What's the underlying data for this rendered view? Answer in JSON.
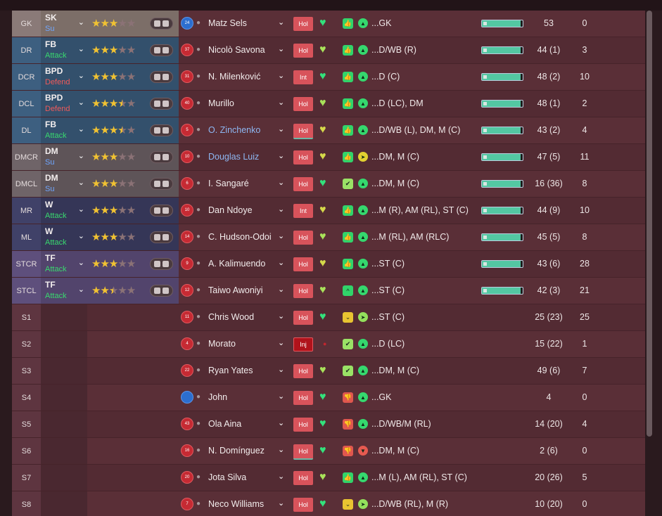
{
  "colors": {
    "row_odd": "#5a2f37",
    "row_even": "#532b33",
    "gk_cell": "#8a7a78",
    "def_cell": "#335677",
    "mid_cell": "#6e6266",
    "wide_cell": "#3f3f66",
    "att_cell": "#5d4d7a",
    "duty_attack": "#39d96f",
    "duty_defend": "#ef5a5a",
    "duty_support": "#6fa6ff",
    "status_hol": "#d8535b",
    "status_inj": "#b0121b",
    "fitness_bar": "#53c7a2"
  },
  "players": [
    {
      "pos": "GK",
      "role": "SK",
      "duty": "Su",
      "duty_type": "support",
      "pos_color": "#8a7a78",
      "role_color": "#7c6e68",
      "stars": 3,
      "shirt": "24",
      "gk": true,
      "name": "Matz Sels",
      "link": false,
      "status": "Hol",
      "heart": "g",
      "sq": "g",
      "sq_icon": "👍",
      "circ": "g",
      "circ_icon": "▲",
      "position_text": "...GK",
      "fitness": 0.95,
      "apps": "53",
      "goals": "0",
      "bar": true
    },
    {
      "pos": "DR",
      "role": "FB",
      "duty": "Attack",
      "duty_type": "attack",
      "pos_color": "#3d5f80",
      "role_color": "#33506c",
      "stars": 3,
      "shirt": "37",
      "gk": false,
      "name": "Nicolò Savona",
      "link": false,
      "status": "Hol",
      "heart": "lg",
      "sq": "g",
      "sq_icon": "👍",
      "circ": "g",
      "circ_icon": "▲",
      "position_text": "...D/WB (R)",
      "fitness": 0.95,
      "apps": "44 (1)",
      "goals": "3",
      "bar": true
    },
    {
      "pos": "DCR",
      "role": "BPD",
      "duty": "Defend",
      "duty_type": "defend",
      "pos_color": "#3d5f80",
      "role_color": "#33506c",
      "stars": 3,
      "shirt": "31",
      "gk": false,
      "name": "N. Milenković",
      "link": false,
      "status": "Int",
      "heart": "g",
      "sq": "g",
      "sq_icon": "👍",
      "circ": "g",
      "circ_icon": "▲",
      "position_text": "...D (C)",
      "fitness": 0.95,
      "apps": "48 (2)",
      "goals": "10",
      "bar": true
    },
    {
      "pos": "DCL",
      "role": "BPD",
      "duty": "Defend",
      "duty_type": "defend",
      "pos_color": "#3d5f80",
      "role_color": "#33506c",
      "stars": 3.5,
      "shirt": "40",
      "gk": false,
      "name": "Murillo",
      "link": false,
      "status": "Hol",
      "heart": "lg",
      "sq": "g",
      "sq_icon": "👍",
      "circ": "g",
      "circ_icon": "▲",
      "position_text": "...D (LC), DM",
      "fitness": 0.95,
      "apps": "48 (1)",
      "goals": "2",
      "bar": true
    },
    {
      "pos": "DL",
      "role": "FB",
      "duty": "Attack",
      "duty_type": "attack",
      "pos_color": "#3d5f80",
      "role_color": "#33506c",
      "stars": 3.5,
      "shirt": "5",
      "gk": false,
      "name": "O. Zinchenko",
      "link": true,
      "status": "Hol",
      "heart": "y",
      "sq": "g",
      "sq_icon": "👍",
      "circ": "g",
      "circ_icon": "▲",
      "position_text": "...D/WB (L), DM, M (C)",
      "fitness": 0.95,
      "apps": "43 (2)",
      "goals": "4",
      "bar": true
    },
    {
      "pos": "DMCR",
      "role": "DM",
      "duty": "Su",
      "duty_type": "support",
      "pos_color": "#6f6468",
      "role_color": "#5e5458",
      "stars": 3,
      "shirt": "10",
      "gk": false,
      "name": "Douglas Luiz",
      "link": true,
      "status": "Hol",
      "heart": "y",
      "sq": "g",
      "sq_icon": "👍",
      "circ": "y",
      "circ_icon": "➤",
      "position_text": "...DM, M (C)",
      "fitness": 0.95,
      "apps": "47 (5)",
      "goals": "11",
      "bar": true
    },
    {
      "pos": "DMCL",
      "role": "DM",
      "duty": "Su",
      "duty_type": "support",
      "pos_color": "#6f6468",
      "role_color": "#5e5458",
      "stars": 3,
      "shirt": "6",
      "gk": false,
      "name": "I. Sangaré",
      "link": false,
      "status": "Hol",
      "heart": "g",
      "sq": "lg",
      "sq_icon": "✔",
      "circ": "g",
      "circ_icon": "▲",
      "position_text": "...DM, M (C)",
      "fitness": 0.95,
      "apps": "16 (36)",
      "goals": "8",
      "bar": true
    },
    {
      "pos": "MR",
      "role": "W",
      "duty": "Attack",
      "duty_type": "attack",
      "pos_color": "#404168",
      "role_color": "#353657",
      "stars": 3,
      "shirt": "10",
      "gk": false,
      "name": "Dan Ndoye",
      "link": false,
      "status": "Int",
      "heart": "y",
      "sq": "g",
      "sq_icon": "👍",
      "circ": "g",
      "circ_icon": "▲",
      "position_text": "...M (R), AM (RL), ST (C)",
      "fitness": 0.95,
      "apps": "44 (9)",
      "goals": "10",
      "bar": true
    },
    {
      "pos": "ML",
      "role": "W",
      "duty": "Attack",
      "duty_type": "attack",
      "pos_color": "#404168",
      "role_color": "#353657",
      "stars": 3,
      "shirt": "14",
      "gk": false,
      "name": "C. Hudson-Odoi",
      "link": false,
      "status": "Hol",
      "heart": "lg",
      "sq": "g",
      "sq_icon": "👍",
      "circ": "g",
      "circ_icon": "▲",
      "position_text": "...M (RL), AM (RLC)",
      "fitness": 0.95,
      "apps": "45 (5)",
      "goals": "8",
      "bar": true
    },
    {
      "pos": "STCR",
      "role": "TF",
      "duty": "Attack",
      "duty_type": "attack",
      "pos_color": "#5e4f7c",
      "role_color": "#52446c",
      "stars": 3,
      "shirt": "9",
      "gk": false,
      "name": "A. Kalimuendo",
      "link": false,
      "status": "Hol",
      "heart": "y",
      "sq": "g",
      "sq_icon": "👍",
      "circ": "g",
      "circ_icon": "▲",
      "position_text": "...ST (C)",
      "fitness": 0.95,
      "apps": "43 (6)",
      "goals": "28",
      "bar": true
    },
    {
      "pos": "STCL",
      "role": "TF",
      "duty": "Attack",
      "duty_type": "attack",
      "pos_color": "#5e4f7c",
      "role_color": "#52446c",
      "stars": 2.5,
      "shirt": "12",
      "gk": false,
      "name": "Taiwo Awoniyi",
      "link": false,
      "status": "Hol",
      "heart": "lg",
      "sq": "g",
      "sq_icon": "^",
      "circ": "g",
      "circ_icon": "▲",
      "position_text": "...ST (C)",
      "fitness": 0.95,
      "apps": "42 (3)",
      "goals": "21",
      "bar": true
    },
    {
      "pos": "S1",
      "role": "",
      "duty": "",
      "duty_type": "",
      "pos_color": "",
      "role_color": "",
      "stars": 0,
      "shirt": "11",
      "gk": false,
      "name": "Chris Wood",
      "link": false,
      "status": "Hol",
      "heart": "g",
      "sq": "y",
      "sq_icon": "⌄",
      "circ": "lg",
      "circ_icon": "➤",
      "position_text": "...ST (C)",
      "fitness": 0,
      "apps": "25 (23)",
      "goals": "25",
      "bar": false
    },
    {
      "pos": "S2",
      "role": "",
      "duty": "",
      "duty_type": "",
      "pos_color": "",
      "role_color": "",
      "stars": 0,
      "shirt": "4",
      "gk": false,
      "name": "Morato",
      "link": false,
      "status": "Inj",
      "heart": "dot",
      "sq": "lg",
      "sq_icon": "✔",
      "circ": "g",
      "circ_icon": "▲",
      "position_text": "...D (LC)",
      "fitness": 0,
      "apps": "15 (22)",
      "goals": "1",
      "bar": false
    },
    {
      "pos": "S3",
      "role": "",
      "duty": "",
      "duty_type": "",
      "pos_color": "",
      "role_color": "",
      "stars": 0,
      "shirt": "22",
      "gk": false,
      "name": "Ryan Yates",
      "link": false,
      "status": "Hol",
      "heart": "lg",
      "sq": "lg",
      "sq_icon": "✔",
      "circ": "g",
      "circ_icon": "▲",
      "position_text": "...DM, M (C)",
      "fitness": 0,
      "apps": "49 (6)",
      "goals": "7",
      "bar": false
    },
    {
      "pos": "S4",
      "role": "",
      "duty": "",
      "duty_type": "",
      "pos_color": "",
      "role_color": "",
      "stars": 0,
      "shirt": "",
      "gk": true,
      "name": "John",
      "link": false,
      "status": "Hol",
      "heart": "g",
      "sq": "r",
      "sq_icon": "👎",
      "circ": "g",
      "circ_icon": "▲",
      "position_text": "...GK",
      "fitness": 0,
      "apps": "4",
      "goals": "0",
      "bar": false
    },
    {
      "pos": "S5",
      "role": "",
      "duty": "",
      "duty_type": "",
      "pos_color": "",
      "role_color": "",
      "stars": 0,
      "shirt": "43",
      "gk": false,
      "name": "Ola Aina",
      "link": false,
      "status": "Hol",
      "heart": "g",
      "sq": "r",
      "sq_icon": "👎",
      "circ": "g",
      "circ_icon": "▲",
      "position_text": "...D/WB/M (RL)",
      "fitness": 0,
      "apps": "14 (20)",
      "goals": "4",
      "bar": false
    },
    {
      "pos": "S6",
      "role": "",
      "duty": "",
      "duty_type": "",
      "pos_color": "",
      "role_color": "",
      "stars": 0,
      "shirt": "16",
      "gk": false,
      "name": "N. Domínguez",
      "link": false,
      "status": "Hol",
      "heart": "g",
      "sq": "r",
      "sq_icon": "👎",
      "circ": "r",
      "circ_icon": "▼",
      "position_text": "...DM, M (C)",
      "fitness": 0,
      "apps": "2 (6)",
      "goals": "0",
      "bar": false
    },
    {
      "pos": "S7",
      "role": "",
      "duty": "",
      "duty_type": "",
      "pos_color": "",
      "role_color": "",
      "stars": 0,
      "shirt": "20",
      "gk": false,
      "name": "Jota Silva",
      "link": false,
      "status": "Hol",
      "heart": "lg",
      "sq": "g",
      "sq_icon": "👍",
      "circ": "g",
      "circ_icon": "▲",
      "position_text": "...M (L), AM (RL), ST (C)",
      "fitness": 0,
      "apps": "20 (26)",
      "goals": "5",
      "bar": false
    },
    {
      "pos": "S8",
      "role": "",
      "duty": "",
      "duty_type": "",
      "pos_color": "",
      "role_color": "",
      "stars": 0,
      "shirt": "7",
      "gk": false,
      "name": "Neco Williams",
      "link": false,
      "status": "Hol",
      "heart": "g",
      "sq": "y",
      "sq_icon": "⌄",
      "circ": "lg",
      "circ_icon": "➤",
      "position_text": "...D/WB (RL), M (R)",
      "fitness": 0,
      "apps": "10 (20)",
      "goals": "0",
      "bar": false
    }
  ]
}
